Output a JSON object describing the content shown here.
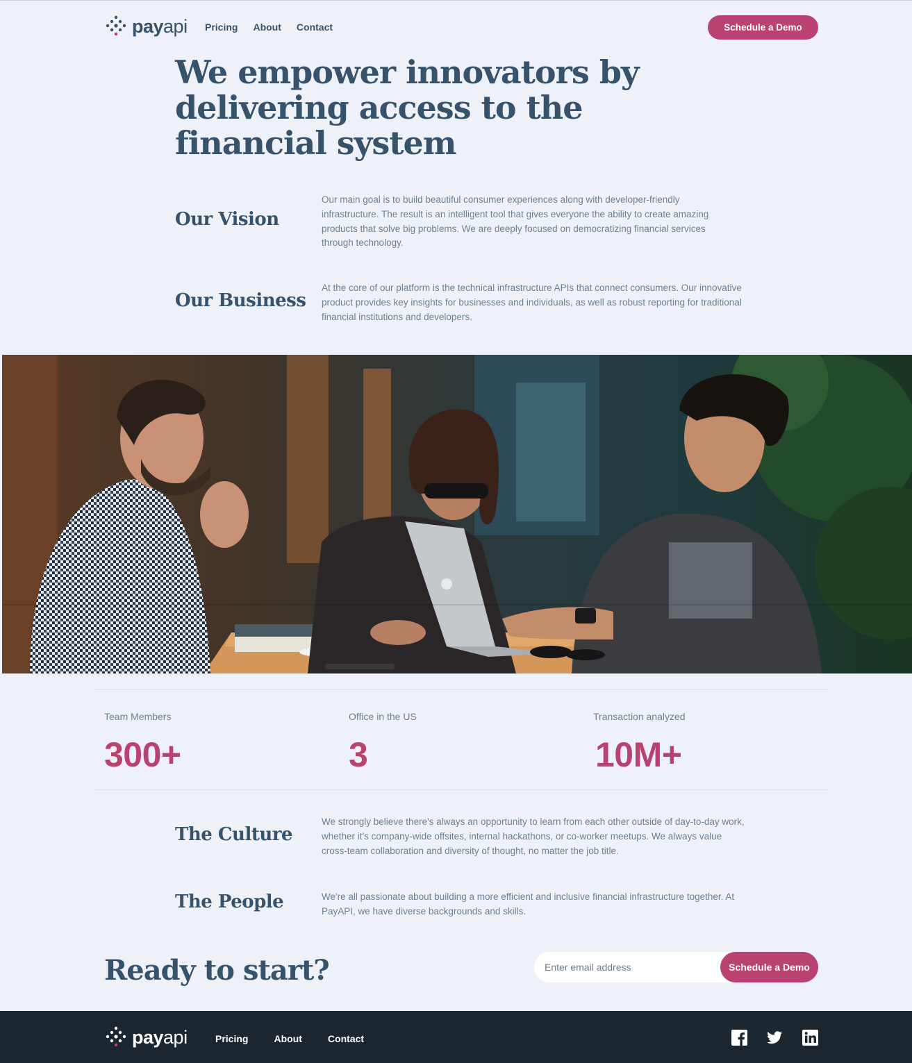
{
  "brand": {
    "name_bold": "pay",
    "name_light": "api"
  },
  "nav": {
    "pricing": "Pricing",
    "about": "About",
    "contact": "Contact"
  },
  "header": {
    "cta": "Schedule a Demo"
  },
  "hero": {
    "title": "We empower innovators by delivering access to the financial system"
  },
  "sections": [
    {
      "title": "Our Vision",
      "text": "Our main goal is to build beautiful consumer experiences along with developer-friendly infrastructure. The result is an intelligent tool that gives everyone the ability to create amazing products that solve big problems. We are deeply focused on democratizing financial services through technology."
    },
    {
      "title": "Our Business",
      "text": "At the core of our platform is the technical infrastructure APIs that connect consumers. Our innovative product provides key insights for businesses and individuals, as well as robust reporting for traditional financial institutions and developers."
    },
    {
      "title": "The Culture",
      "text": "We strongly believe there's always an opportunity to learn from each other outside of day-to-day work, whether it's company-wide offsites, internal hackathons, or co-worker meetups. We always value cross-team collaboration and diversity of thought, no matter the job title."
    },
    {
      "title": "The People",
      "text": "We're all passionate about building a more efficient and inclusive financial infrastructure together. At PayAPI, we have diverse backgrounds and skills."
    }
  ],
  "stats": [
    {
      "label": "Team Members",
      "value": "300+"
    },
    {
      "label": "Office in the US",
      "value": "3"
    },
    {
      "label": "Transaction analyzed",
      "value": "10M+"
    }
  ],
  "cta": {
    "title": "Ready to start?",
    "placeholder": "Enter email address",
    "button": "Schedule a Demo"
  },
  "footer": {
    "nav": {
      "pricing": "Pricing",
      "about": "About",
      "contact": "Contact"
    },
    "socials": [
      "facebook-icon",
      "twitter-icon",
      "linkedin-icon"
    ]
  },
  "colors": {
    "accent": "#ba4270",
    "text": "#36536b",
    "muted": "#6c7f92",
    "background": "#eef2f8",
    "footer": "#1b262f"
  }
}
